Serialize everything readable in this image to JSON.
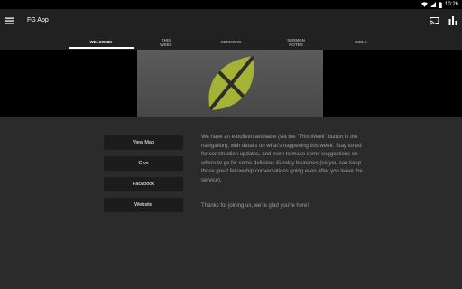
{
  "status_bar": {
    "time": "10:26"
  },
  "app_bar": {
    "title": "FG App",
    "icons": [
      "menu-icon",
      "cast-icon",
      "stats-icon"
    ]
  },
  "tabs": [
    {
      "label": "WELCOME!",
      "active": true
    },
    {
      "label": "THIS\nWEEK",
      "active": false
    },
    {
      "label": "SERMONS",
      "active": false
    },
    {
      "label": "SERMON\nNOTES",
      "active": false
    },
    {
      "label": "BIBLE",
      "active": false
    }
  ],
  "buttons": {
    "view_map": "View Map",
    "give": "Give",
    "facebook": "Facebook",
    "website": "Website"
  },
  "welcome_text": {
    "paragraph_1": "We have an e-bulletin available (via the \"This Week\" button in the navigation), with details on what's happening this week. Stay tuned for construction updates, and even to make some suggestions on where to go for some delicious Sunday brunches (so you can keep those great fellowship conversations going even after you leave the service).",
    "paragraph_2": "Thanks for joining us, we're glad you're here!"
  },
  "colors": {
    "app_bar": "#212121",
    "background": "#2b2b2b",
    "button": "#1c1c1c",
    "logo_green": "#a4b236",
    "logo_dark": "#2d2d2d"
  }
}
